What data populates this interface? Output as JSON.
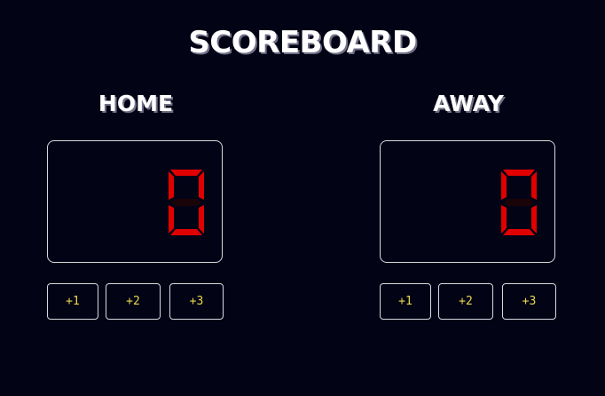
{
  "title": "SCOREBOARD",
  "colors": {
    "background": "#030316",
    "digit_on": "#e00000",
    "digit_off": "#1a0407",
    "button_text": "#e8d84a",
    "border": "#d8d8e0"
  },
  "teams": [
    {
      "name": "HOME",
      "score": "0",
      "buttons": [
        "+1",
        "+2",
        "+3"
      ]
    },
    {
      "name": "AWAY",
      "score": "0",
      "buttons": [
        "+1",
        "+2",
        "+3"
      ]
    }
  ]
}
